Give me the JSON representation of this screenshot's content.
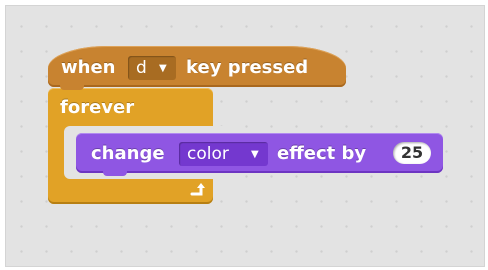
{
  "hat_block": {
    "prefix": "when",
    "key": "d",
    "suffix": "key pressed"
  },
  "forever_block": {
    "label": "forever"
  },
  "looks_block": {
    "prefix": "change",
    "effect": "color",
    "middle": "effect by",
    "amount": "25"
  },
  "colors": {
    "events": "#c88330",
    "control": "#e1a226",
    "looks": "#8f56e3"
  },
  "icons": [
    "dropdown-arrow-icon",
    "loop-arrow-icon"
  ]
}
